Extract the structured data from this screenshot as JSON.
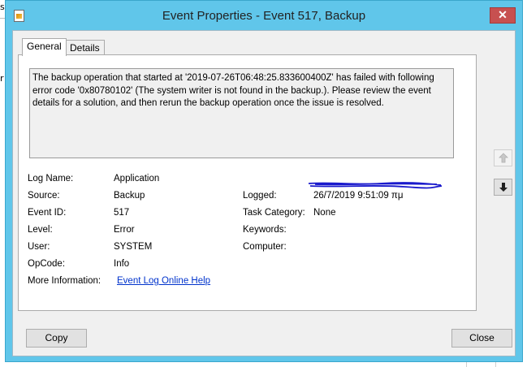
{
  "window": {
    "title": "Event Properties - Event 517, Backup",
    "close_glyph": "✕"
  },
  "background": {
    "frag_top": "s",
    "frag_mid": "r"
  },
  "tabs": [
    {
      "label": "General",
      "active": true
    },
    {
      "label": "Details",
      "active": false
    }
  ],
  "description": "The backup operation that started at '2019-07-26T06:48:25.833600400Z' has failed with following error code '0x80780102' (The system writer is not found in the backup.). Please review the event details for a solution, and then rerun the backup operation once the issue is resolved.",
  "fields": {
    "log_name_label": "Log Name:",
    "log_name_value": "Application",
    "source_label": "Source:",
    "source_value": "Backup",
    "logged_label": "Logged:",
    "logged_value": "26/7/2019 9:51:09 πμ",
    "event_id_label": "Event ID:",
    "event_id_value": "517",
    "task_category_label": "Task Category:",
    "task_category_value": "None",
    "level_label": "Level:",
    "level_value": "Error",
    "keywords_label": "Keywords:",
    "keywords_value": "",
    "user_label": "User:",
    "user_value": "SYSTEM",
    "computer_label": "Computer:",
    "opcode_label": "OpCode:",
    "opcode_value": "Info",
    "more_info_label": "More Information:",
    "more_info_link": "Event Log Online Help"
  },
  "nav": {
    "up_icon": "arrow-up-icon",
    "down_icon": "arrow-down-icon"
  },
  "buttons": {
    "copy": "Copy",
    "close": "Close"
  },
  "colors": {
    "title_bar": "#60c6ea",
    "close_button": "#c75050",
    "link": "#0033cc",
    "redaction": "#1a1acc"
  }
}
